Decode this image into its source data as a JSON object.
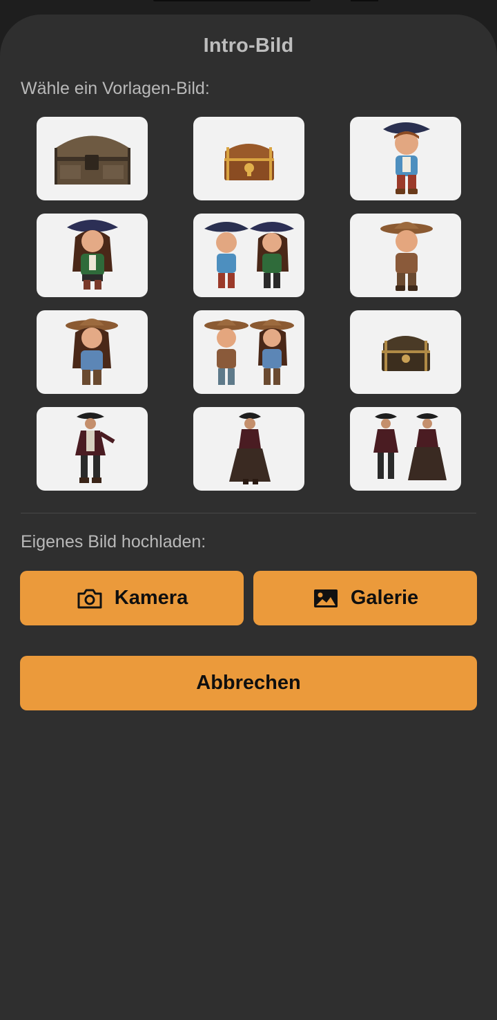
{
  "sheet": {
    "title": "Intro-Bild",
    "templates_label": "Wähle ein Vorlagen-Bild:",
    "upload_label": "Eigenes Bild hochladen:"
  },
  "templates": [
    {
      "kind": "chest-wooden"
    },
    {
      "kind": "chest-small"
    },
    {
      "kind": "pirate-boy"
    },
    {
      "kind": "pirate-girl"
    },
    {
      "kind": "pirate-kids-pair"
    },
    {
      "kind": "cowboy-boy"
    },
    {
      "kind": "cowgirl"
    },
    {
      "kind": "cowboy-kids-pair"
    },
    {
      "kind": "chest-ornate"
    },
    {
      "kind": "pirate-man"
    },
    {
      "kind": "pirate-woman"
    },
    {
      "kind": "pirate-adults-pair"
    }
  ],
  "buttons": {
    "camera_label": "Kamera",
    "camera_icon": "camera-icon",
    "gallery_label": "Galerie",
    "gallery_icon": "image-icon",
    "cancel_label": "Abbrechen"
  },
  "colors": {
    "sheet_background": "#2f2f2f",
    "button_accent": "#eb9a3b",
    "tile_background": "#f2f2f2"
  }
}
